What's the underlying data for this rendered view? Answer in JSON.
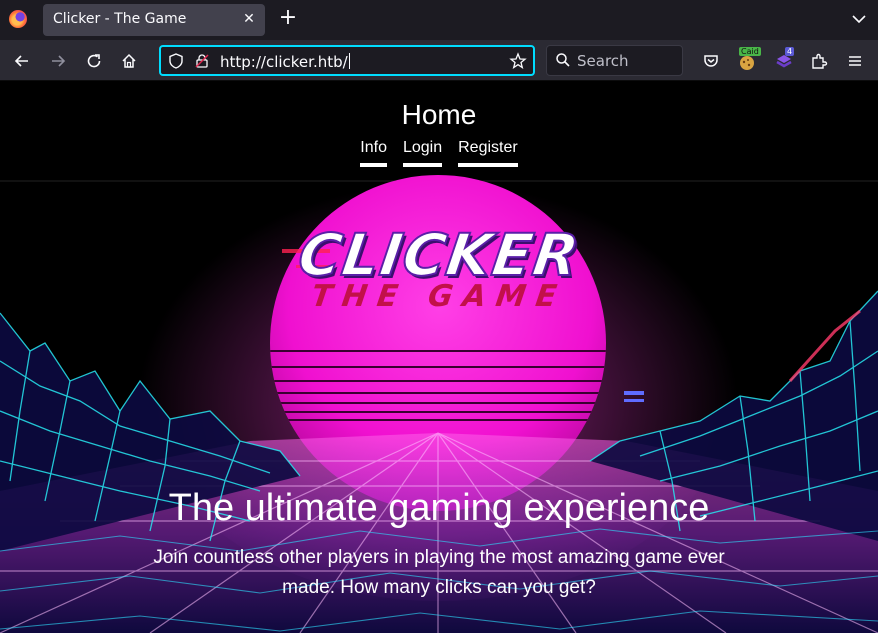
{
  "browser": {
    "tab": {
      "title": "Clicker - The Game"
    },
    "url": "http://clicker.htb/",
    "search_placeholder": "Search",
    "extensions": [
      {
        "name": "cookie-editor-icon",
        "badge": "Caid"
      },
      {
        "name": "wappalyzer-icon",
        "badge": "4"
      }
    ]
  },
  "site": {
    "title": "Home",
    "nav": [
      "Info",
      "Login",
      "Register"
    ],
    "logo_main": "CLICKER",
    "logo_sub": "THE GAME",
    "hero_title": "The ultimate gaming experience",
    "hero_subtitle": "Join countless other players in playing the most amazing game ever made. How many clicks can you get?"
  },
  "colors": {
    "accent_focus": "#00ddff",
    "sun": "#ff1ad9",
    "grid": "#27e6f0",
    "logo_red": "#c2104a"
  }
}
